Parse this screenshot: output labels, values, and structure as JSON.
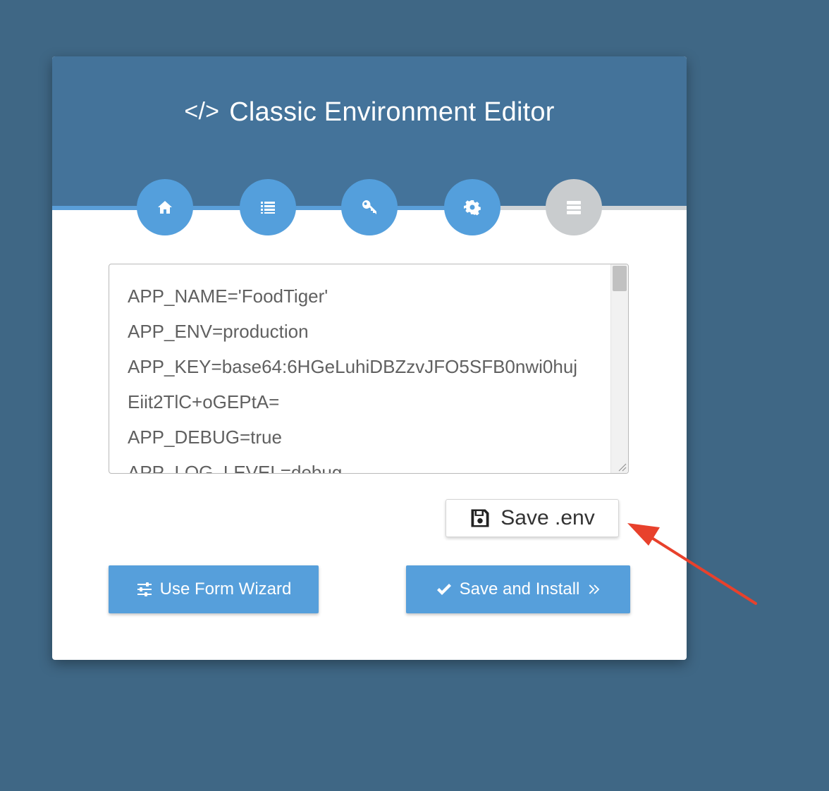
{
  "header": {
    "title": "Classic Environment Editor",
    "title_icon": "code-icon"
  },
  "steps": [
    {
      "icon": "home-icon",
      "state": "complete"
    },
    {
      "icon": "list-icon",
      "state": "complete"
    },
    {
      "icon": "key-icon",
      "state": "complete"
    },
    {
      "icon": "gear-icon",
      "state": "complete"
    },
    {
      "icon": "server-icon",
      "state": "inactive"
    }
  ],
  "editor": {
    "lines": [
      "APP_NAME='FoodTiger'",
      "APP_ENV=production",
      "APP_KEY=base64:6HGeLuhiDBZzvJFO5SFB0nwi0huj",
      "Eiit2TlC+oGEPtA=",
      "APP_DEBUG=true",
      "APP_LOG_LEVEL=debug"
    ]
  },
  "buttons": {
    "save_env": "Save .env",
    "use_form_wizard": "Use Form Wizard",
    "save_and_install": "Save and Install"
  },
  "colors": {
    "background": "#3f6785",
    "header": "#44739a",
    "accent": "#549fdc",
    "inactive": "#c9ccce",
    "annotation_arrow": "#e8412c"
  }
}
